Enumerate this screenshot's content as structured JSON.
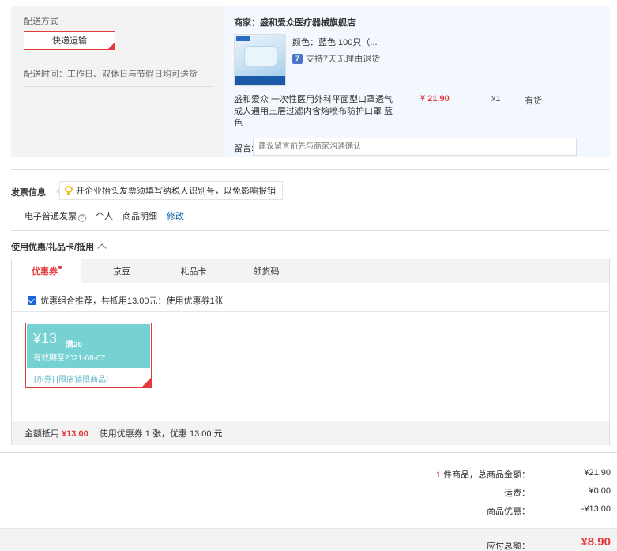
{
  "shipping": {
    "label": "配送方式",
    "method": "快递运输",
    "time": "配送时间：工作日、双休日与节假日均可送货"
  },
  "product": {
    "shop": "商家：盛和爱众医疗器械旗舰店",
    "color": "颜色：蓝色 100只（...",
    "return_policy": "支持7天无理由退货",
    "name": "盛和爱众 一次性医用外科平面型口罩透气成人通用三层过滤内含熔喷布防护口罩 蓝色",
    "price": "¥ 21.90",
    "qty": "x1",
    "stock": "有货",
    "note_label": "留言:",
    "note_placeholder": "建议留言前先与商家沟通确认"
  },
  "invoice": {
    "title": "发票信息",
    "tip": "开企业抬头发票须填写纳税人识别号，以免影响报销",
    "type": "电子普通发票",
    "info_icon": "?",
    "person": "个人",
    "detail": "商品明细",
    "edit": "修改"
  },
  "coupon": {
    "title": "使用优惠/礼品卡/抵用",
    "tabs": [
      "优惠券",
      "京豆",
      "礼品卡",
      "领货码"
    ],
    "combo": "优惠组合推荐，共抵用13.00元：使用优惠券1张",
    "card": {
      "amount": "¥13",
      "condition": "满20",
      "valid": "有效期至2021-08-07",
      "tags": "[东券] [限店铺限商品]"
    },
    "footer_label": "金额抵用",
    "footer_amount": "¥13.00",
    "footer_detail": "使用优惠券 1 张，优惠 13.00 元"
  },
  "summary": {
    "items_count": "1",
    "items_label": "件商品，总商品金额：",
    "items_total": "¥21.90",
    "shipping_label": "运费：",
    "shipping_val": "¥0.00",
    "discount_label": "商品优惠：",
    "discount_val": "-¥13.00",
    "total_label": "应付总额：",
    "total_val": "¥8.90"
  }
}
